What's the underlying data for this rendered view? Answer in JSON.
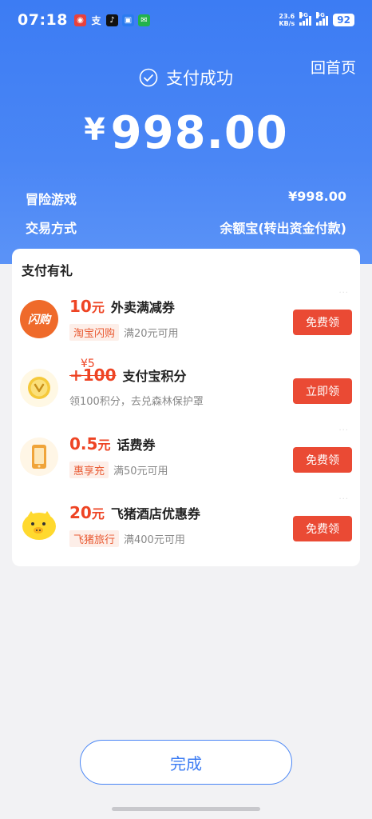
{
  "status_bar": {
    "time": "07:18",
    "net_speed_value": "23.6",
    "net_speed_unit": "KB/s",
    "sig1_label": "5G",
    "sig2_label": "5G",
    "battery": "92"
  },
  "header": {
    "home_link": "回首页",
    "success_text": "支付成功",
    "currency": "¥",
    "amount": "998.00"
  },
  "info": {
    "item_label": "冒险游戏",
    "item_amount": "¥998.00",
    "method_label": "交易方式",
    "method_value": "余额宝(转出资金付款)"
  },
  "gifts": {
    "title": "支付有礼",
    "items": [
      {
        "value": "10",
        "unit": "元",
        "name": "外卖满减券",
        "tag": "淘宝闪购",
        "note": "满20元可用",
        "button": "免费领",
        "icon": "shangou-icon",
        "icon_text": "闪购"
      },
      {
        "strike": "¥5",
        "value": "+100",
        "unit": "",
        "name": "支付宝积分",
        "tag": "",
        "note": "领100积分，去兑森林保护罩",
        "button": "立即领",
        "icon": "points-coin-icon"
      },
      {
        "value": "0.5",
        "unit": "元",
        "name": "话费券",
        "tag": "惠享充",
        "note": "满50元可用",
        "button": "免费领",
        "icon": "phone-icon"
      },
      {
        "value": "20",
        "unit": "元",
        "name": "飞猪酒店优惠券",
        "tag": "飞猪旅行",
        "note": "满400元可用",
        "button": "免费领",
        "icon": "fliggy-pig-icon"
      }
    ]
  },
  "footer": {
    "done_label": "完成"
  },
  "colors": {
    "brand_blue": "#3c7cf3",
    "accent_red": "#ea4a34"
  }
}
